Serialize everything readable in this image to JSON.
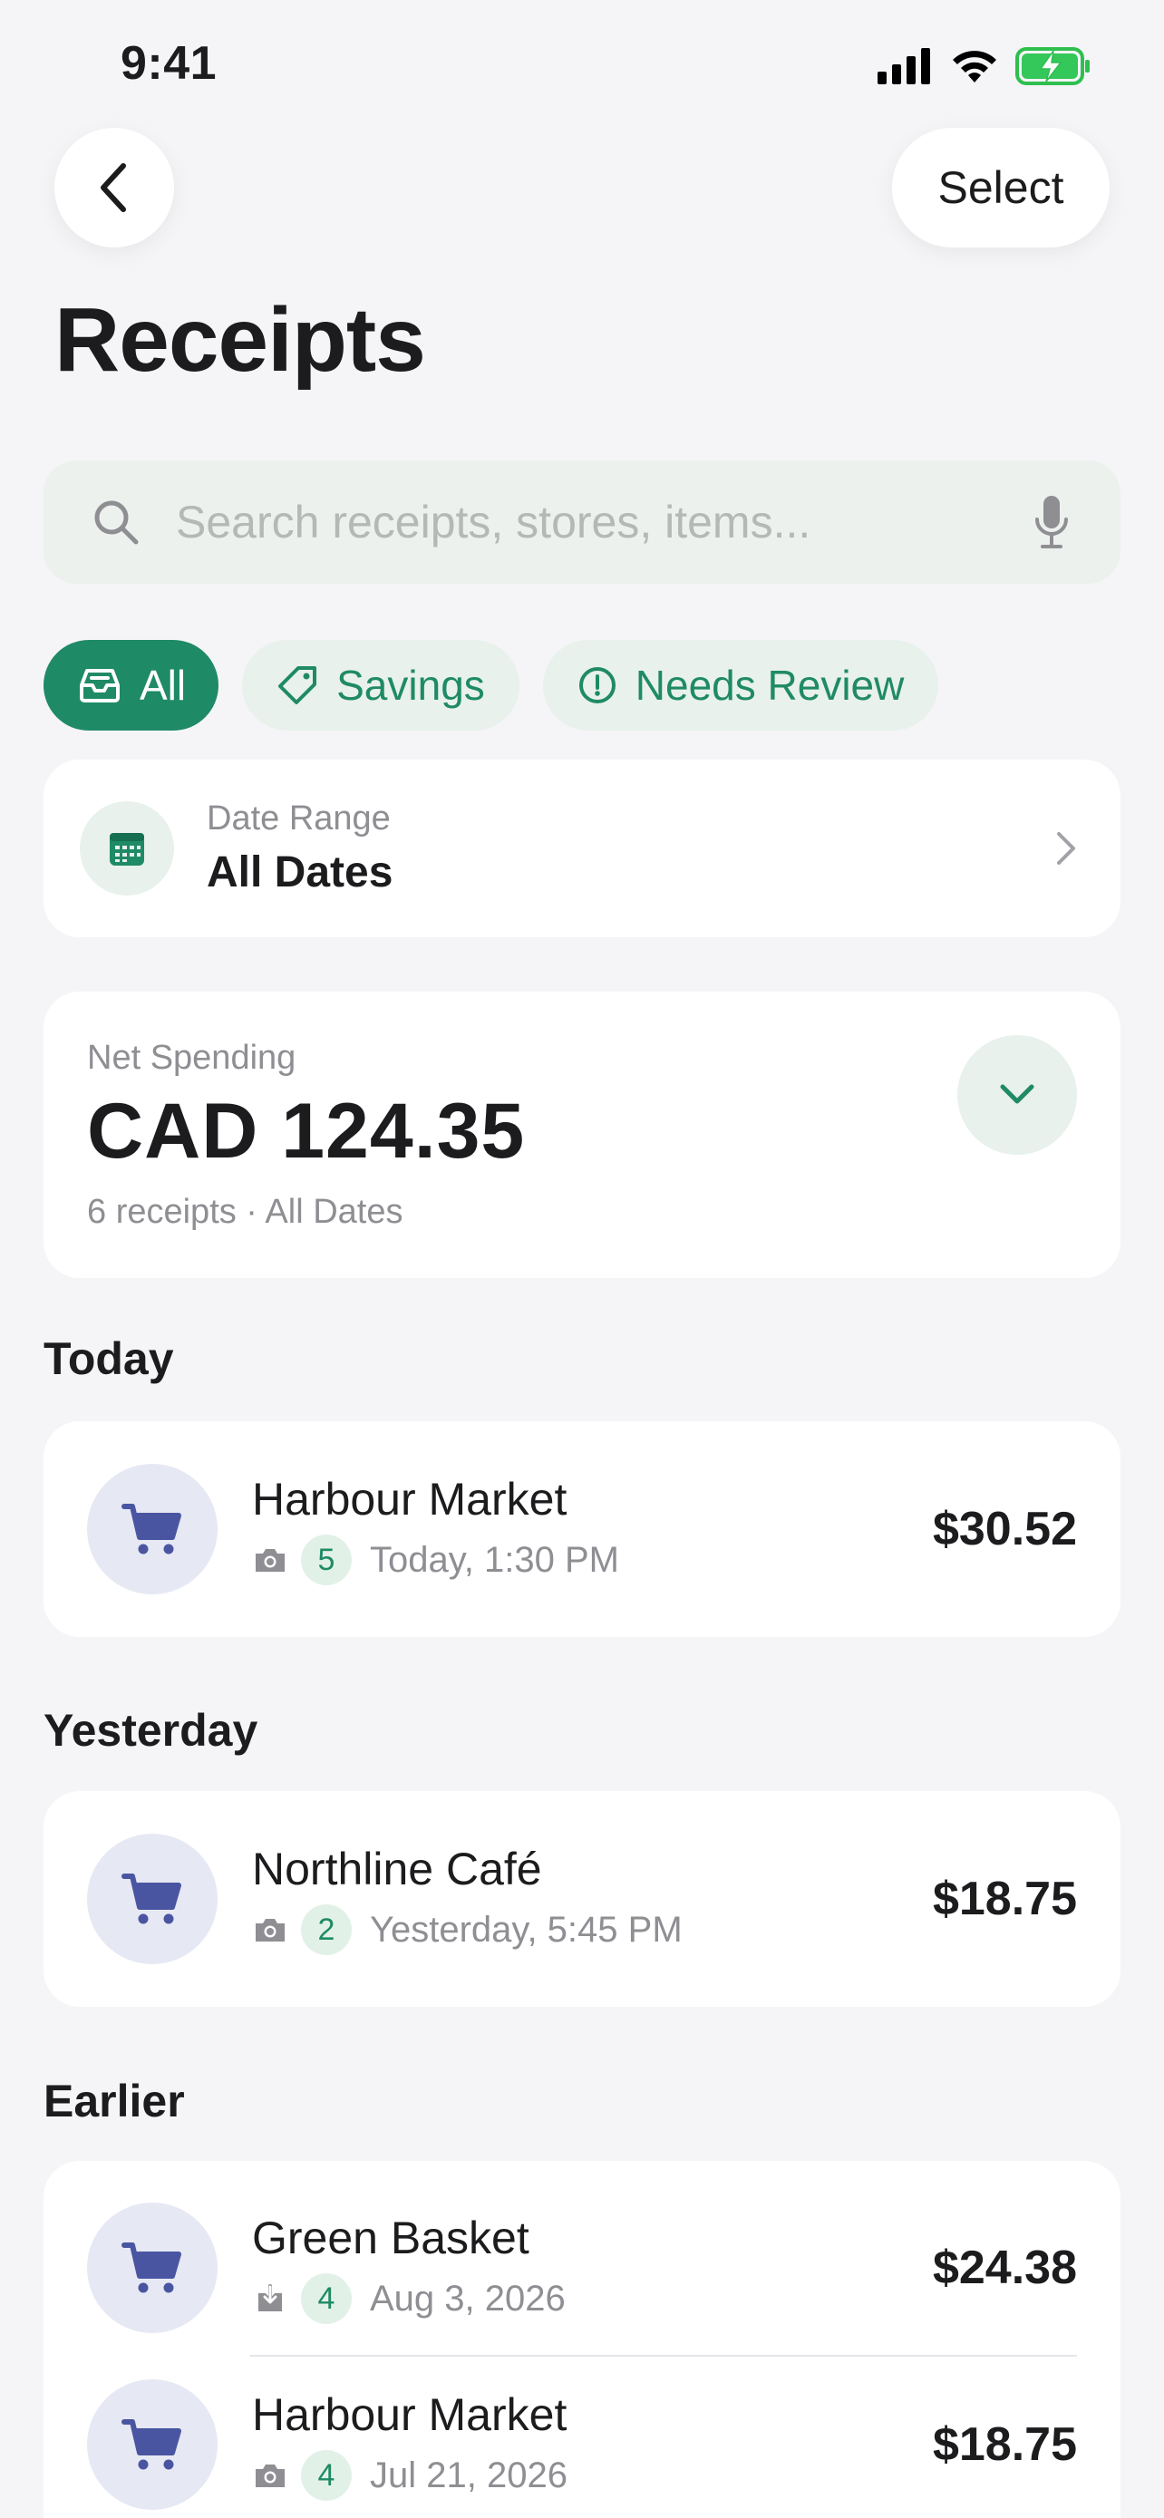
{
  "status_bar": {
    "time": "9:41"
  },
  "nav": {
    "select_label": "Select"
  },
  "header": {
    "title": "Receipts"
  },
  "search": {
    "placeholder": "Search receipts, stores, items..."
  },
  "filters": [
    {
      "label": "All",
      "active": true,
      "icon": "tray-icon"
    },
    {
      "label": "Savings",
      "active": false,
      "icon": "tag-icon"
    },
    {
      "label": "Needs Review",
      "active": false,
      "icon": "alert-circle-icon"
    }
  ],
  "date_range": {
    "label": "Date Range",
    "value": "All Dates"
  },
  "net_spending": {
    "label": "Net Spending",
    "amount": "CAD 124.35",
    "summary": "6 receipts · All Dates"
  },
  "sections": [
    {
      "title": "Today",
      "receipts": [
        {
          "store": "Harbour Market",
          "source": "camera-icon",
          "count": "5",
          "date": "Today, 1:30 PM",
          "amount": "$30.52"
        }
      ]
    },
    {
      "title": "Yesterday",
      "receipts": [
        {
          "store": "Northline Café",
          "source": "camera-icon",
          "count": "2",
          "date": "Yesterday, 5:45 PM",
          "amount": "$18.75"
        }
      ]
    },
    {
      "title": "Earlier",
      "receipts": [
        {
          "store": "Green Basket",
          "source": "import-icon",
          "count": "4",
          "date": "Aug 3, 2026",
          "amount": "$24.38"
        },
        {
          "store": "Harbour Market",
          "source": "camera-icon",
          "count": "4",
          "date": "Jul 21, 2026",
          "amount": "$18.75"
        }
      ]
    }
  ],
  "colors": {
    "accent": "#1f8a66",
    "accent_soft": "#e8f1ec",
    "cart": "#4a55a2",
    "background": "#f5f5f7"
  }
}
